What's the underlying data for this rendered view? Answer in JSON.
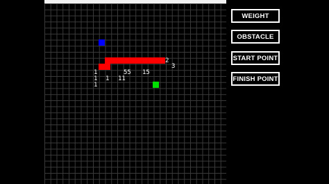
{
  "buttons": {
    "weight": "WEIGHT",
    "obstacle": "OBSTACLE",
    "start_point": "START POINT",
    "finish_point": "FINISH POINT"
  },
  "colors": {
    "start": "#0000ff",
    "finish": "#00e000",
    "obstacle": "#ff0000",
    "grid_line": "#3b3b3b",
    "background": "#000000"
  },
  "weights": {
    "w_2": "2",
    "w_3": "3",
    "r1_1": "1",
    "r1_55": "55",
    "r1_15": "15",
    "r2_1a": "1",
    "r2_1b": "1",
    "r2_11": "11",
    "r3_1": "1"
  }
}
